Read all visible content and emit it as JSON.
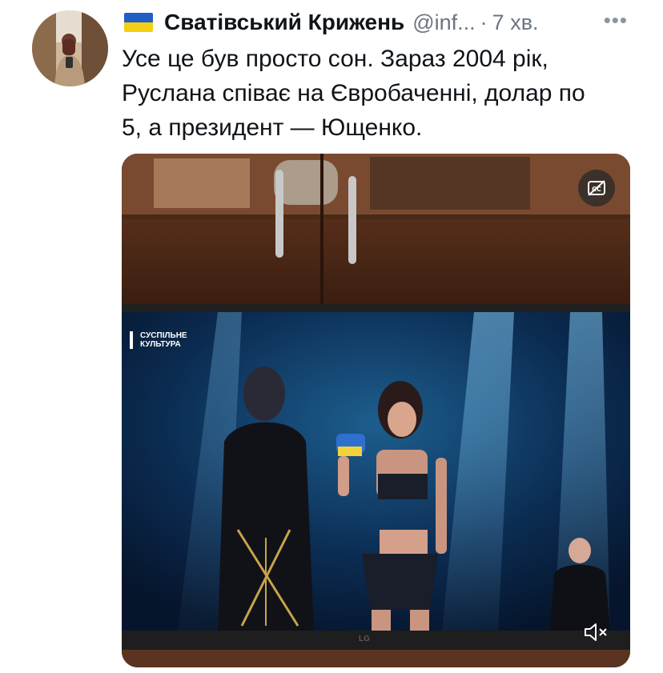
{
  "tweet": {
    "flag_emoji": "ukraine-flag",
    "display_name": "Сватівський Крижень",
    "handle": "@inf...",
    "separator": "·",
    "time": "7 хв.",
    "more_label": "•••",
    "text": [
      "Усе це був просто сон. Зараз 2004 рік,",
      "Руслана співає на Євробаченні, долар по",
      "5, а президент — Ющенко."
    ]
  },
  "media": {
    "tv_logo_line1": "СУСПІЛЬНЕ",
    "tv_logo_line2": "КУЛЬТУРА",
    "tv_brand": "LG",
    "cc_icon": "captions-off-icon",
    "mute_icon": "volume-muted-icon"
  },
  "colors": {
    "name": "#0f1419",
    "secondary": "#6b7580",
    "flag_blue": "#1f5fc4",
    "flag_yellow": "#f5cf14"
  }
}
